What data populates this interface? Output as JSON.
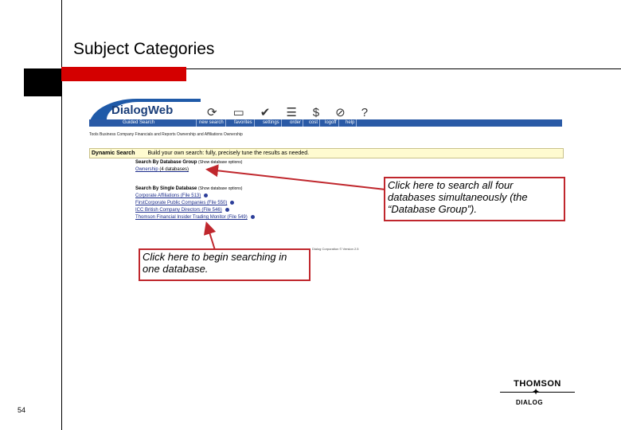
{
  "slide": {
    "title": "Subject Categories",
    "page_number": "54",
    "accent_color": "#d40000"
  },
  "app": {
    "logo": "DialogWeb",
    "toolbar_icons": [
      "refresh-icon",
      "book-icon",
      "check-icon",
      "list-icon",
      "dollar-icon",
      "logoff-icon",
      "help-icon"
    ],
    "nav": [
      "Guided Search",
      "new search",
      "favorites",
      "settings",
      "order",
      "cost",
      "logoff",
      "help"
    ],
    "tabs": "Tools  Business  Company Financials and Reports  Ownership and Affiliations  Ownership",
    "dynamic_search": {
      "label": "Dynamic Search",
      "desc": "Build your own search: fully, precisely tune the results as needed."
    },
    "group_section": {
      "heading": "Search By Database Group",
      "options": "(Show database options)",
      "link": "Ownership",
      "count": "(4 databases)"
    },
    "single_section": {
      "heading": "Search By Single Database",
      "options": "(Show database options)",
      "items": [
        "Corporate Affiliations (File 513)",
        "FirstCorporate Public Companies (File 550)",
        "ICC British Company Directors (File 546)",
        "Thomson Financial Insider Trading Monitor (File 549)"
      ]
    },
    "copyright": "Dialog Corporation ©  Version 2.5"
  },
  "callouts": {
    "group": "Click here to search all four databases simultaneously (the “Database Group”).",
    "single": "Click here to begin searching in one database."
  },
  "logo": {
    "top": "THOMSON",
    "star": "✦",
    "bottom": "DIALOG"
  }
}
